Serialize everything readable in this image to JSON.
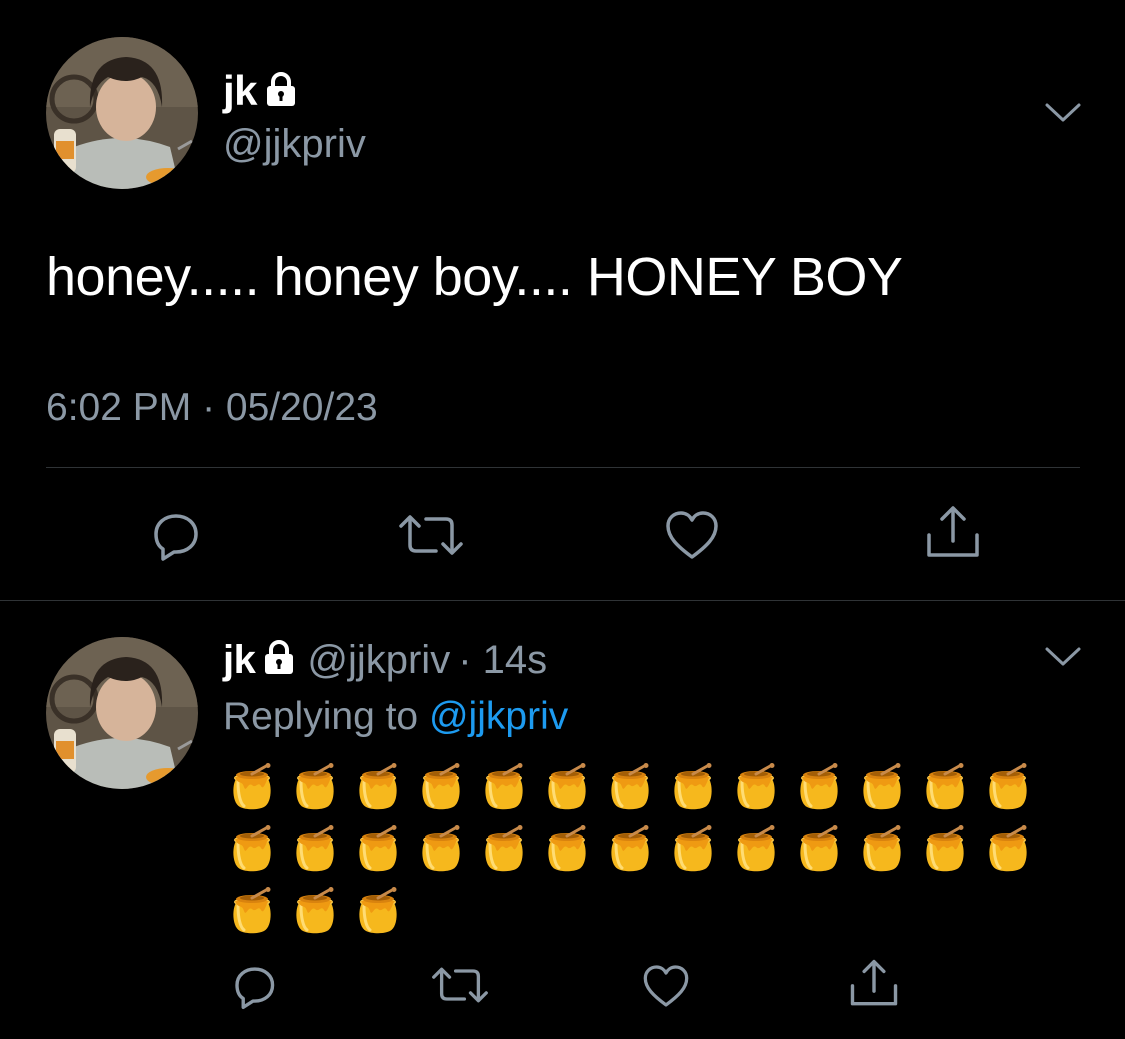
{
  "main_tweet": {
    "display_name": "jk",
    "handle": "@jjkpriv",
    "text": "honey..... honey boy.... HONEY BOY",
    "timestamp": "6:02 PM · 05/20/23",
    "icons": [
      "lock-icon",
      "chevron-down-icon",
      "reply-icon",
      "retweet-icon",
      "like-icon",
      "share-icon"
    ]
  },
  "reply_tweet": {
    "display_name": "jk",
    "handle": "@jjkpriv",
    "time_ago": "· 14s",
    "replying_prefix": "Replying to",
    "replying_mention": "@jjkpriv",
    "honey_pot_count": 29,
    "honey_pot_glyph": "🍯",
    "icons": [
      "lock-icon",
      "chevron-down-icon",
      "reply-icon",
      "retweet-icon",
      "like-icon",
      "share-icon"
    ]
  },
  "colors": {
    "background": "#000000",
    "text": "#ffffff",
    "secondary_text": "#8b98a5",
    "mention": "#1d9bf0",
    "divider": "#2f3336"
  }
}
